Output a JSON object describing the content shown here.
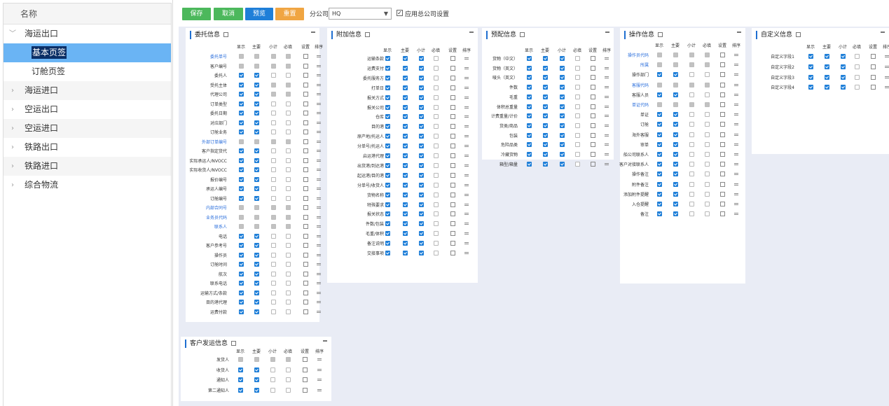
{
  "sidebar": {
    "header": "名称",
    "items": [
      {
        "label": "海运出口",
        "type": "parent",
        "caret": "﹀"
      },
      {
        "label": "基本页签",
        "type": "child",
        "selected": true
      },
      {
        "label": "订舱页签",
        "type": "child"
      },
      {
        "label": "海运进口",
        "type": "parent",
        "caret": "›"
      },
      {
        "label": "空运出口",
        "type": "parent",
        "caret": "›"
      },
      {
        "label": "空运进口",
        "type": "parent",
        "caret": "›"
      },
      {
        "label": "铁路出口",
        "type": "parent",
        "caret": "›"
      },
      {
        "label": "铁路进口",
        "type": "parent",
        "caret": "›"
      },
      {
        "label": "综合物流",
        "type": "parent",
        "caret": "›"
      }
    ]
  },
  "toolbar": {
    "save": "保存",
    "cancel": "取消",
    "preview": "预览",
    "reset": "重置",
    "branch_label": "分公司",
    "branch_value": "HQ",
    "apply_all_label": "应用总公司设置",
    "apply_all_checked": true
  },
  "colors": {
    "green": "#4cb85c",
    "blue": "#1f7fd8",
    "orange": "#f0a542",
    "selected_row": "#6ab4f4",
    "panel_bg": "#e9ecf5"
  },
  "panels": [
    {
      "title": "委托信息",
      "headers": [
        "显示",
        "主要",
        "小计",
        "必填",
        "设置",
        "排序"
      ],
      "rows": [
        {
          "label": "委托单号",
          "link": true,
          "s": "dddde"
        },
        {
          "label": "客户编号",
          "s": "ddde"
        },
        {
          "label": "委托人",
          "s": "bboe"
        },
        {
          "label": "受托主体",
          "s": "bbde"
        },
        {
          "label": "代理公司",
          "s": "bbde"
        },
        {
          "label": "订单类型",
          "s": "bboe"
        },
        {
          "label": "委托日期",
          "s": "bboe"
        },
        {
          "label": "对应部门",
          "s": "bboe"
        },
        {
          "label": "订舱业务",
          "s": "bboe"
        },
        {
          "label": "外部订单编号",
          "link": true,
          "s": "ddde"
        },
        {
          "label": "客户指定货代",
          "s": "bboe"
        },
        {
          "label": "实际承运人/NVOCC",
          "s": "bboe"
        },
        {
          "label": "实际收货人/NVOCC",
          "s": "bboe"
        },
        {
          "label": "报价编号",
          "s": "bboe"
        },
        {
          "label": "承运人编号",
          "s": "bboe"
        },
        {
          "label": "订舱编号",
          "s": "bboe"
        },
        {
          "label": "内部合同号",
          "link": true,
          "s": "ddde"
        },
        {
          "label": "业务员代码",
          "link": true,
          "s": "ddde"
        },
        {
          "label": "联系人",
          "link": true,
          "s": "ddde"
        },
        {
          "label": "电话",
          "s": "bboe"
        },
        {
          "label": "客户参考号",
          "s": "bboe"
        },
        {
          "label": "操作员",
          "s": "bboe"
        },
        {
          "label": "订舱时间",
          "s": "bboe"
        },
        {
          "label": "航次",
          "s": "bboe"
        },
        {
          "label": "联系电话",
          "s": "bboe"
        },
        {
          "label": "运输方式/条款",
          "s": "bboe"
        },
        {
          "label": "目的港代理",
          "s": "bboe"
        },
        {
          "label": "运费付款",
          "s": "bboe"
        }
      ]
    },
    {
      "title": "附加信息",
      "headers": [
        "显示",
        "主要",
        "小计",
        "必填",
        "设置",
        "排序"
      ],
      "rows": [
        {
          "label": "运输条款",
          "s": "bbboe"
        },
        {
          "label": "运费支付",
          "s": "bbboe"
        },
        {
          "label": "委托服务方",
          "s": "bbboe"
        },
        {
          "label": "打单日",
          "s": "bbboe"
        },
        {
          "label": "报关方式",
          "s": "bbboe"
        },
        {
          "label": "报关公司",
          "s": "bbboe"
        },
        {
          "label": "仓库",
          "s": "bbboe"
        },
        {
          "label": "目的港",
          "s": "bbboe"
        },
        {
          "label": "原产地/托运人",
          "s": "bbboe"
        },
        {
          "label": "分单号/托运人",
          "s": "bbboe"
        },
        {
          "label": "启运港代理",
          "s": "bbboe"
        },
        {
          "label": "出货港/到达港",
          "s": "bbboe"
        },
        {
          "label": "起运港/目的港",
          "s": "bbboe"
        },
        {
          "label": "分单号/收货人",
          "s": "bbboe"
        },
        {
          "label": "货物名称",
          "s": "bbboe"
        },
        {
          "label": "特殊要求",
          "s": "bbboe"
        },
        {
          "label": "报关状态",
          "s": "bbboe"
        },
        {
          "label": "件数/包装",
          "s": "bbboe"
        },
        {
          "label": "毛重/体积",
          "s": "bbboe"
        },
        {
          "label": "备注说明",
          "s": "bbboe"
        },
        {
          "label": "交接事项",
          "s": "bbboe"
        }
      ]
    },
    {
      "title": "预配信息",
      "headers": [
        "显示",
        "主要",
        "小计",
        "必填",
        "设置",
        "排序"
      ],
      "rows": [
        {
          "label": "货物（中文）",
          "s": "bbboe"
        },
        {
          "label": "货物（英文）",
          "s": "bbboe"
        },
        {
          "label": "唛头（英文）",
          "s": "bbboe"
        },
        {
          "label": "件数",
          "s": "bbboe"
        },
        {
          "label": "毛重",
          "s": "bbboe"
        },
        {
          "label": "体积总重量",
          "s": "bbboe"
        },
        {
          "label": "计费重量/计价",
          "s": "bbboe"
        },
        {
          "label": "货类/商品",
          "s": "bbboe"
        },
        {
          "label": "包装",
          "s": "bbboe"
        },
        {
          "label": "危险品类",
          "s": "bbboe"
        },
        {
          "label": "冷藏货物",
          "s": "bbboe"
        },
        {
          "label": "箱型/箱量",
          "s": "bbboe"
        }
      ]
    },
    {
      "title": "操作信息",
      "headers": [
        "显示",
        "主要",
        "小计",
        "必填",
        "设置",
        "排序"
      ],
      "rows": [
        {
          "label": "操作员代码",
          "link": true,
          "s": "ddde"
        },
        {
          "label": "所属",
          "link": true,
          "s": "ddde"
        },
        {
          "label": "操作部门",
          "s": "bboe"
        },
        {
          "label": "客服代码",
          "link": true,
          "s": "ddde"
        },
        {
          "label": "客服人员",
          "s": "bboe"
        },
        {
          "label": "单证代码",
          "link": true,
          "s": "ddde"
        },
        {
          "label": "单证",
          "s": "bboe"
        },
        {
          "label": "订舱",
          "s": "bboe"
        },
        {
          "label": "海外客服",
          "s": "bboe"
        },
        {
          "label": "审单",
          "s": "bboe"
        },
        {
          "label": "船公司联系人",
          "s": "bboe"
        },
        {
          "label": "客户对接联系人",
          "s": "bboe"
        },
        {
          "label": "操作备注",
          "s": "bboe"
        },
        {
          "label": "附件备注",
          "s": "bboe"
        },
        {
          "label": "添加附件提醒",
          "s": "bboe"
        },
        {
          "label": "入仓提醒",
          "s": "bboe"
        },
        {
          "label": "备注",
          "s": "bboe"
        }
      ]
    },
    {
      "title": "自定义信息",
      "headers": [
        "显示",
        "主要",
        "小计",
        "必填",
        "设置",
        "排序"
      ],
      "rows": [
        {
          "label": "自定义字段1",
          "s": "bbboe"
        },
        {
          "label": "自定义字段2",
          "s": "bbboe"
        },
        {
          "label": "自定义字段3",
          "s": "bbboe"
        },
        {
          "label": "自定义字段4",
          "s": "bbboe"
        }
      ]
    },
    {
      "title": "客户发运信息",
      "headers": [
        "显示",
        "主要",
        "小计",
        "必填",
        "设置",
        "排序"
      ],
      "rows": [
        {
          "label": "发货人",
          "s": "ddde"
        },
        {
          "label": "收货人",
          "s": "bboe"
        },
        {
          "label": "通知人",
          "s": "bboe"
        },
        {
          "label": "第二通知人",
          "s": "bboe"
        }
      ]
    }
  ]
}
